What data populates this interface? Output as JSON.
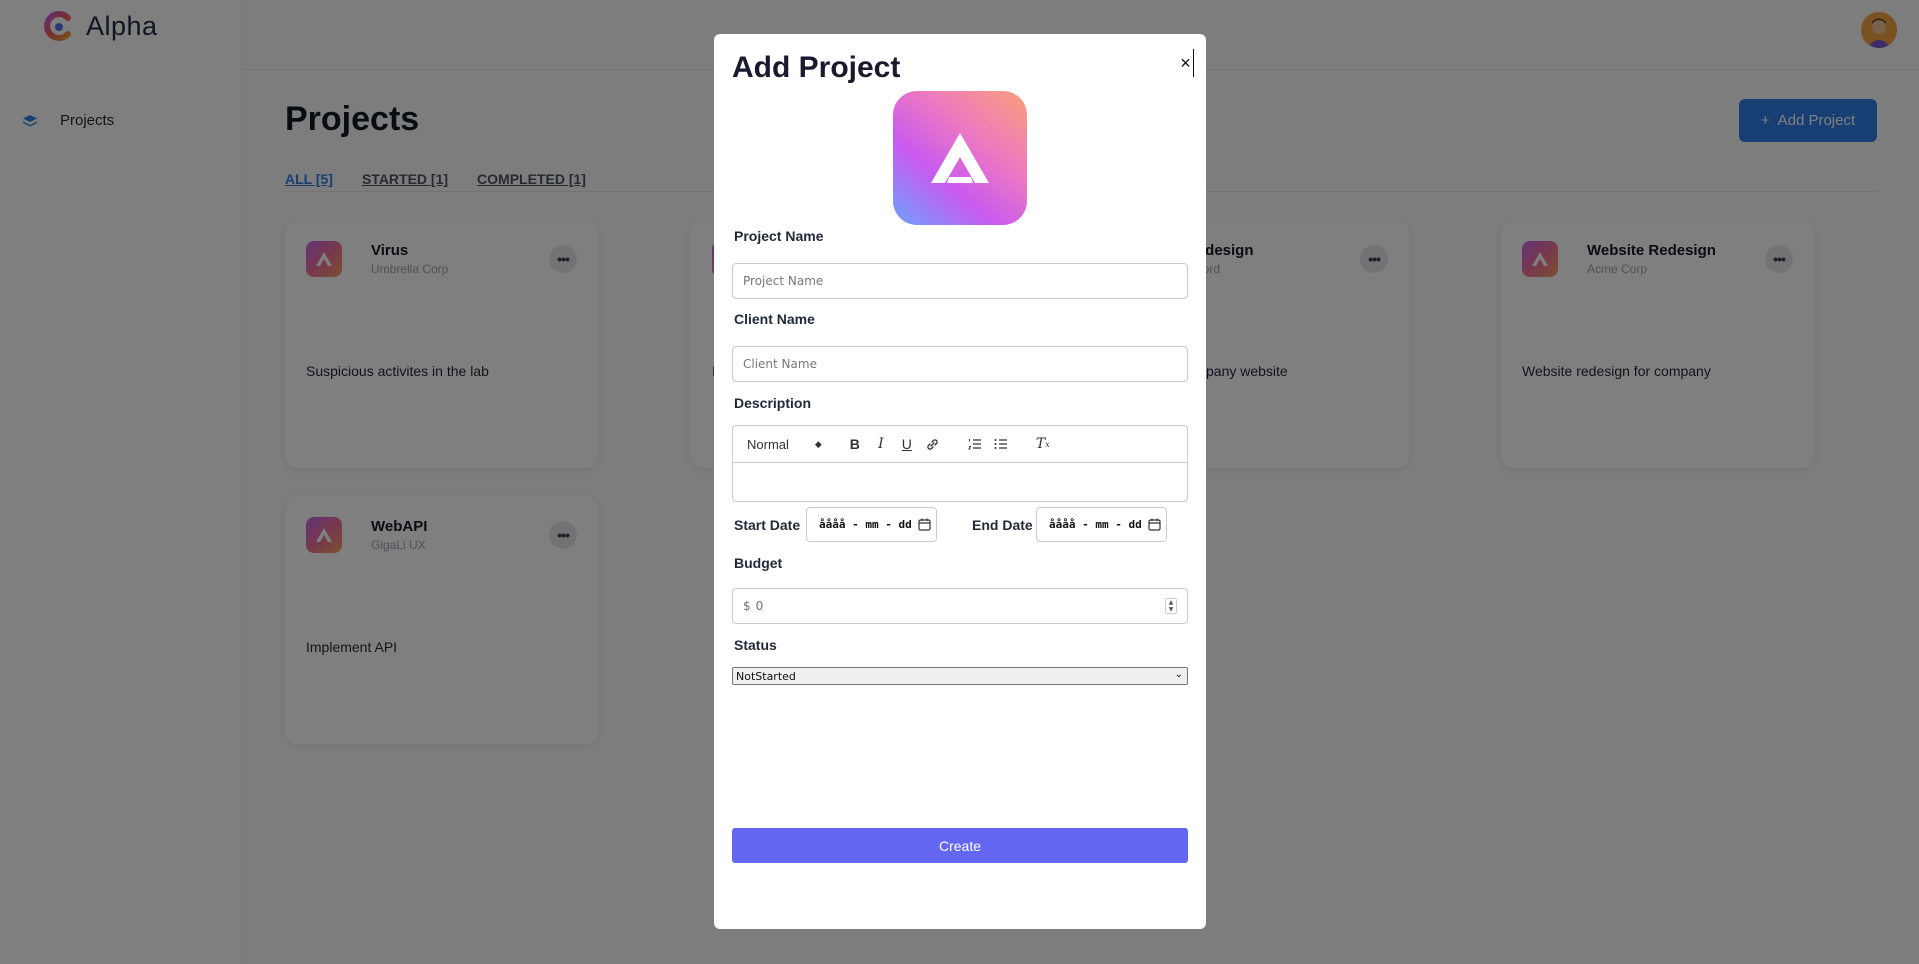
{
  "app": {
    "name": "Alpha"
  },
  "sidebar": {
    "items": [
      {
        "label": "Projects",
        "icon": "stack-icon"
      }
    ]
  },
  "page": {
    "title": "Projects",
    "add_button_label": "Add Project",
    "tabs": [
      {
        "label": "ALL [5]",
        "active": true
      },
      {
        "label": "STARTED [1]",
        "active": false
      },
      {
        "label": "COMPLETED [1]",
        "active": false
      }
    ]
  },
  "projects": [
    {
      "name": "Virus",
      "client": "Umbrella Corp",
      "description": "Suspicious activites in the lab"
    },
    {
      "name": "",
      "client": "",
      "description": "I"
    },
    {
      "name": "odesign",
      "client": "oord",
      "description": "pany website"
    },
    {
      "name": "Website Redesign",
      "client": "Acme Corp",
      "description": "Website redesign for company"
    },
    {
      "name": "WebAPI",
      "client": "GigaLi UX",
      "description": "Implement API"
    }
  ],
  "modal": {
    "title": "Add Project",
    "close_glyph": "×",
    "project_name": {
      "label": "Project Name",
      "placeholder": "Project Name",
      "value": ""
    },
    "client_name": {
      "label": "Client Name",
      "placeholder": "Client Name",
      "value": ""
    },
    "description": {
      "label": "Description",
      "format_select": "Normal"
    },
    "start_date": {
      "label": "Start Date",
      "placeholder": "åååå - mm - dd"
    },
    "end_date": {
      "label": "End Date",
      "placeholder": "åååå - mm - dd"
    },
    "budget": {
      "label": "Budget",
      "currency": "$",
      "value": "0"
    },
    "status": {
      "label": "Status",
      "selected": "NotStarted"
    },
    "submit_label": "Create"
  },
  "colors": {
    "primary_blue": "#2f7fe6",
    "create_button": "#6366f1",
    "overlay": "rgba(0,0,0,0.5)"
  }
}
